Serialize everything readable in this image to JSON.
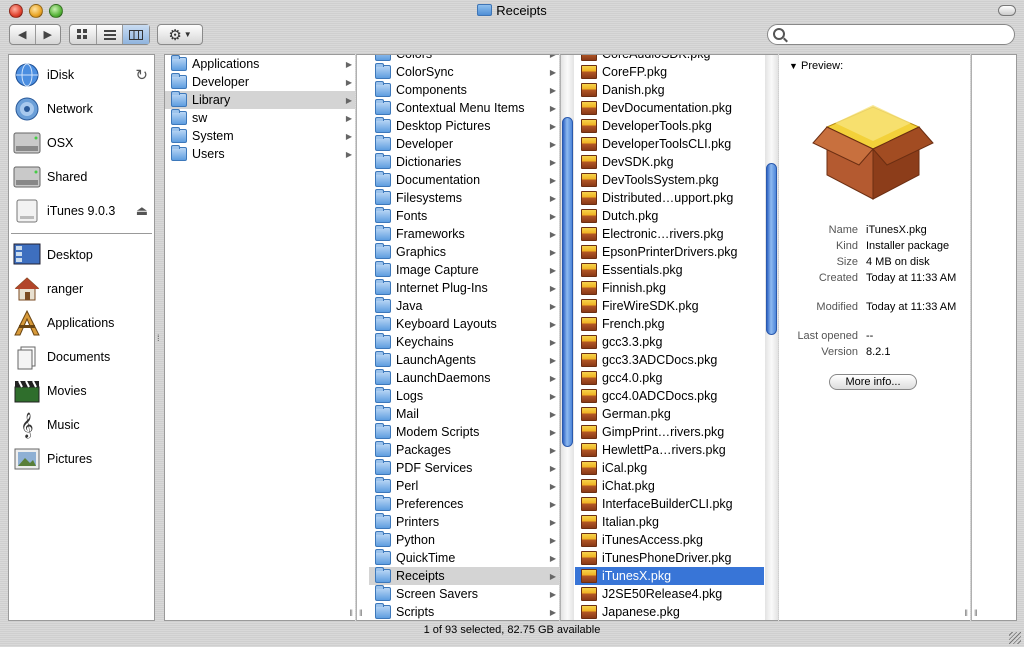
{
  "window": {
    "title": "Receipts",
    "status": "1 of 93 selected, 82.75 GB available"
  },
  "toolbar": {
    "back_icon": "back-arrow-icon",
    "forward_icon": "forward-arrow-icon",
    "view_icons": [
      "icon-view-icon",
      "list-view-icon",
      "column-view-icon"
    ],
    "action_icon": "gear-icon",
    "search_placeholder": ""
  },
  "sidebar": {
    "devices": [
      {
        "label": "iDisk",
        "icon": "idisk-icon",
        "extra": "↻"
      },
      {
        "label": "Network",
        "icon": "network-icon",
        "extra": ""
      },
      {
        "label": "OSX",
        "icon": "hard-disk-icon",
        "extra": ""
      },
      {
        "label": "Shared",
        "icon": "hard-disk-icon",
        "extra": ""
      },
      {
        "label": "iTunes 9.0.3",
        "icon": "disk-image-icon",
        "extra": "⏏"
      }
    ],
    "places": [
      {
        "label": "Desktop",
        "icon": "desktop-icon"
      },
      {
        "label": "ranger",
        "icon": "home-icon"
      },
      {
        "label": "Applications",
        "icon": "applications-icon"
      },
      {
        "label": "Documents",
        "icon": "documents-icon"
      },
      {
        "label": "Movies",
        "icon": "movies-icon"
      },
      {
        "label": "Music",
        "icon": "music-icon"
      },
      {
        "label": "Pictures",
        "icon": "pictures-icon"
      }
    ]
  },
  "column1": {
    "items": [
      "Applications",
      "Developer",
      "Library",
      "sw",
      "System",
      "Users"
    ],
    "selected": "Library"
  },
  "column2": {
    "items": [
      "Colors",
      "ColorSync",
      "Components",
      "Contextual Menu Items",
      "Desktop Pictures",
      "Developer",
      "Dictionaries",
      "Documentation",
      "Filesystems",
      "Fonts",
      "Frameworks",
      "Graphics",
      "Image Capture",
      "Internet Plug-Ins",
      "Java",
      "Keyboard Layouts",
      "Keychains",
      "LaunchAgents",
      "LaunchDaemons",
      "Logs",
      "Mail",
      "Modem Scripts",
      "Packages",
      "PDF Services",
      "Perl",
      "Preferences",
      "Printers",
      "Python",
      "QuickTime",
      "Receipts",
      "Screen Savers",
      "Scripts"
    ],
    "selected": "Receipts"
  },
  "column3": {
    "items": [
      "CoreAudioSDK.pkg",
      "CoreFP.pkg",
      "Danish.pkg",
      "DevDocumentation.pkg",
      "DeveloperTools.pkg",
      "DeveloperToolsCLI.pkg",
      "DevSDK.pkg",
      "DevToolsSystem.pkg",
      "Distributed…upport.pkg",
      "Dutch.pkg",
      "Electronic…rivers.pkg",
      "EpsonPrinterDrivers.pkg",
      "Essentials.pkg",
      "Finnish.pkg",
      "FireWireSDK.pkg",
      "French.pkg",
      "gcc3.3.pkg",
      "gcc3.3ADCDocs.pkg",
      "gcc4.0.pkg",
      "gcc4.0ADCDocs.pkg",
      "German.pkg",
      "GimpPrint…rivers.pkg",
      "HewlettPa…rivers.pkg",
      "iCal.pkg",
      "iChat.pkg",
      "InterfaceBuilderCLI.pkg",
      "Italian.pkg",
      "iTunesAccess.pkg",
      "iTunesPhoneDriver.pkg",
      "iTunesX.pkg",
      "J2SE50Release4.pkg",
      "Japanese.pkg"
    ],
    "selected": "iTunesX.pkg"
  },
  "preview": {
    "header": "Preview:",
    "icon": "installer-package-icon",
    "info": [
      {
        "key": "Name",
        "value": "iTunesX.pkg"
      },
      {
        "key": "Kind",
        "value": "Installer package"
      },
      {
        "key": "Size",
        "value": "4 MB on disk"
      },
      {
        "key": "Created",
        "value": "Today at 11:33 AM"
      },
      {
        "key": "Modified",
        "value": "Today at 11:33 AM"
      },
      {
        "key": "Last opened",
        "value": "--"
      },
      {
        "key": "Version",
        "value": "8.2.1"
      }
    ],
    "more_info": "More info..."
  },
  "colors": {
    "selection": "#3875d7",
    "inactive_selection": "#d4d4d4",
    "scroll_thumb": "#4d86da"
  }
}
